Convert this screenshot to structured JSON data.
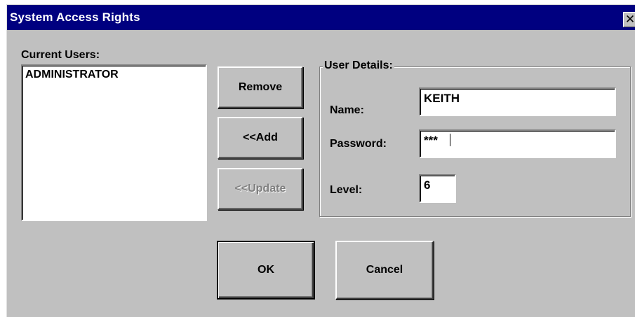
{
  "window": {
    "title": "System Access Rights",
    "close_glyph": "✕",
    "close_icon": "close-icon"
  },
  "users": {
    "label": "Current Users:",
    "items": [
      "ADMINISTRATOR"
    ]
  },
  "actions": {
    "remove": "Remove",
    "add": "<<Add",
    "update": "<<Update"
  },
  "details": {
    "legend": "User Details:",
    "name_label": "Name:",
    "name_value": "KEITH",
    "password_label": "Password:",
    "password_value": "***",
    "level_label": "Level:",
    "level_value": "6"
  },
  "footer": {
    "ok": "OK",
    "cancel": "Cancel"
  }
}
